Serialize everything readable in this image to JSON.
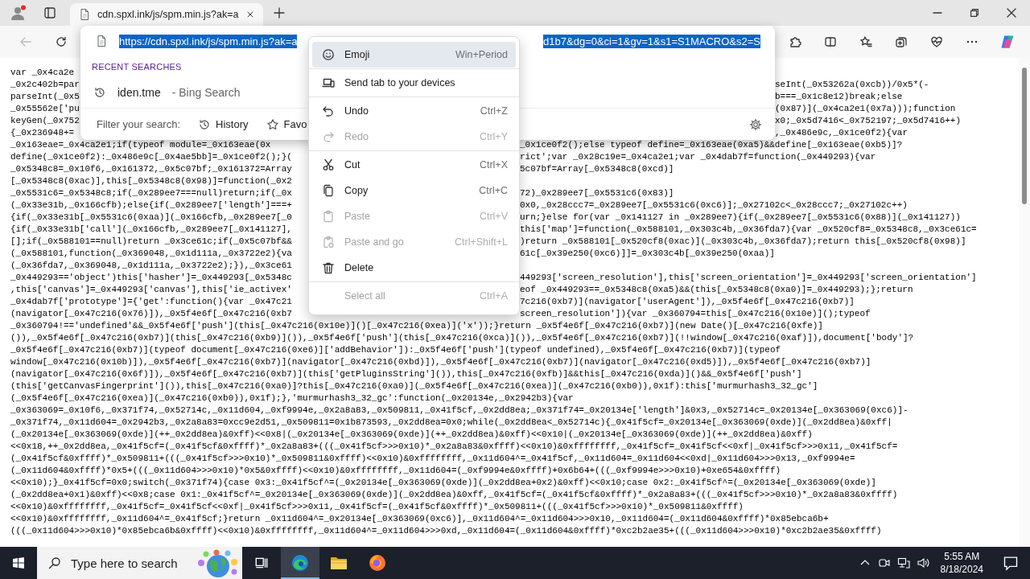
{
  "tabs": [
    {
      "title": "cdn.spxl.ink/js/spm.min.js?ak=a",
      "selected": true
    }
  ],
  "address_dropdown": {
    "url_start": "https://cdn.spxl.ink/js/spm.min.js?ak=a",
    "url_end": "d1b7&dg=0&ci=1&gv=1&s1=S1MACRO&s2=S",
    "url_selected": true,
    "section_title": "RECENT SEARCHES",
    "recent": [
      {
        "query": "iden.tme",
        "source": "- Bing Search"
      }
    ],
    "filter_label": "Filter your search:",
    "filters": [
      {
        "kind": "history",
        "label": "History"
      },
      {
        "kind": "favorites",
        "label": "Favo"
      }
    ]
  },
  "context_menu": {
    "groups": [
      [
        {
          "kind": "emoji",
          "label": "Emoji",
          "shortcut": "Win+Period",
          "highlighted": true,
          "disabled": false
        }
      ],
      [
        {
          "kind": "send",
          "label": "Send tab to your devices",
          "highlighted": false,
          "disabled": false
        }
      ],
      [
        {
          "kind": "undo",
          "label": "Undo",
          "shortcut": "Ctrl+Z",
          "highlighted": false,
          "disabled": false
        },
        {
          "kind": "redo",
          "label": "Redo",
          "shortcut": "Ctrl+Y",
          "highlighted": false,
          "disabled": true
        }
      ],
      [
        {
          "kind": "cut",
          "label": "Cut",
          "shortcut": "Ctrl+X",
          "highlighted": false,
          "disabled": false
        },
        {
          "kind": "copy",
          "label": "Copy",
          "shortcut": "Ctrl+C",
          "highlighted": false,
          "disabled": false
        },
        {
          "kind": "paste",
          "label": "Paste",
          "shortcut": "Ctrl+V",
          "highlighted": false,
          "disabled": true
        },
        {
          "kind": "paste-go",
          "label": "Paste and go",
          "shortcut": "Ctrl+Shift+L",
          "highlighted": false,
          "disabled": true
        },
        {
          "kind": "delete",
          "label": "Delete",
          "highlighted": false,
          "disabled": false
        }
      ],
      [
        {
          "kind": "select-all",
          "label": "Select all",
          "shortcut": "Ctrl+A",
          "highlighted": false,
          "disabled": true
        }
      ]
    ]
  },
  "code_lines": [
    {
      "left": "var _0x4ca2e"
    },
    {
      "left": "_0x2c402b=par",
      "right": "seInt(_0x53262a(0xcb))/0x5*(-"
    },
    {
      "left": "parseInt(_0x5",
      "right": "b===_0x1c8e12)break;else"
    },
    {
      "left": "_0x55562e['pu",
      "right": "(0x87)](_0x4ca2e1(0x7a)));function"
    },
    {
      "left": "keyGen(_0x752",
      "right": "x0;_0x5d7416<_0x752197;_0x5d7416++)"
    },
    {
      "left": "{_0x236948+=",
      "right": ",_0x486e9c,_0x1ce0f2){var"
    },
    {
      "left": "_0x163eae=_0x4ca2e1;if(typeof module=_0x163eae(0x",
      "right": "_0x1ce0f2();else typeof define=_0x163eae(0xa5)&&define[_0x163eae(0xb5)]?"
    },
    {
      "left": "define(_0x1ce0f2):_0x486e9c[_0x4ae5bb]=_0x1ce0f2();}(",
      "right": "rict';var _0x28c19e=_0x4ca2e1;var _0x4dab7f=function(_0x449293){var"
    },
    {
      "left": "_0x5348c8=_0x10f6,_0x161372,_0x5c07bf;_0x161372=Array",
      "right": "5c07bf=Array[_0x5348c8(0xcd)]"
    },
    {
      "left": "[_0x5348c8(0xac)],this[_0x5348c8(0x98)]=function(_0x2"
    },
    {
      "left": "_0x5531c6=_0x5348c8;if(_0x289ee7===null)return;if(_0x",
      "right": "72)_0x289ee7[_0x5531c6(0x83)]"
    },
    {
      "left": "(_0x33e31b,_0x166cfb);else{if(_0x289ee7['length']===+",
      "right": "0x0,_0x28ccc7=_0x289ee7[_0x5531c6(0xc6)];_0x27102c<_0x28ccc7;_0x27102c++)"
    },
    {
      "left": "{if(_0x33e31b[_0x5531c6(0xaa)](_0x166cfb,_0x289ee7[_0",
      "right": "urn;}else for(var _0x141127 in _0x289ee7){if(_0x289ee7[_0x5531c6(0x88)](_0x141127))"
    },
    {
      "left": "{if(_0x33e31b['call'](_0x166cfb,_0x289ee7[_0x141127],",
      "right": "this['map']=function(_0x588101,_0x303c4b,_0x36fda7){var _0x520cf8=_0x5348c8,_0x3ce61c="
    },
    {
      "left": "[];if(_0x588101==null)return _0x3ce61c;if(_0x5c07bf&&",
      "right": ")return _0x588101[_0x520cf8(0xac)](_0x303c4b,_0x36fda7);return this[_0x520cf8(0x98)]"
    },
    {
      "left": "(_0x588101,function(_0x369048,_0x1d111a,_0x3722e2){va",
      "right": "61c[_0x39e250(0xc6)]]=_0x303c4b[_0x39e250(0xaa)]"
    },
    {
      "left": "(_0x36fda7,_0x369048,_0x1d111a,_0x3722e2);}),_0x3ce61"
    },
    {
      "left": "_0x449293=='object')this['hasher']=_0x449293[_0x5348c",
      "right": "449293['screen_resolution'],this['screen_orientation']=_0x449293['screen_orientation']"
    },
    {
      "left": ",this['canvas']=_0x449293['canvas'],this['ie_activex'",
      "right": "eof _0x449293==_0x5348c8(0xa5)&&(this[_0x5348c8(0xa0)]=_0x449293);};return"
    },
    {
      "left": "_0x4dab7f['prototype']={'get':function(){var _0x47c21",
      "right": "7c216(0xb7)](navigator['userAgent']),_0x5f4e6f[_0x47c216(0xb7)]"
    },
    {
      "left": "(navigator[_0x47c216(0x76)]),_0x5f4e6f[_0x47c216(0xb7",
      "right": "screen_resolution']){var _0x360794=this[_0x47c216(0x10e)]();typeof"
    },
    {
      "text": "_0x360794!=='undefined'&&_0x5f4e6f['push'](this[_0x47c216(0x10e)]()[_0x47c216(0xea)]('x'));}return _0x5f4e6f[_0x47c216(0xb7)](new Date()[_0x47c216(0xfe)]"
    },
    {
      "text": "()),_0x5f4e6f[_0x47c216(0xb7)](this[_0x47c216(0xb9)]()),_0x5f4e6f['push'](this[_0x47c216(0xca)]()),_0x5f4e6f[_0x47c216(0xb7)](!!window[_0x47c216(0xaf)]),document['body']?"
    },
    {
      "text": "_0x5f4e6f[_0x47c216(0xb7)](typeof document[_0x47c216(0xe6)]['addBehavior']):_0x5f4e6f['push'](typeof undefined),_0x5f4e6f[_0x47c216(0xb7)](typeof"
    },
    {
      "text": "window[_0x47c216(0x10b)]),_0x5f4e6f[_0x47c216(0xb7)](navigator[_0x47c216(0xbd)]),_0x5f4e6f[_0x47c216(0xb7)](navigator[_0x47c216(0xd5)]),_0x5f4e6f[_0x47c216(0xb7)]"
    },
    {
      "text": "(navigator[_0x47c216(0x6f)]),_0x5f4e6f[_0x47c216(0xb7)](this['getPluginsString']()),this[_0x47c216(0xfb)]&&this[_0x47c216(0xda)]()&&_0x5f4e6f['push']"
    },
    {
      "text": "(this['getCanvasFingerprint']()),this[_0x47c216(0xa0)]?this[_0x47c216(0xa0)](_0x5f4e6f[_0x47c216(0xea)](_0x47c216(0xb0)),0x1f):this['murmurhash3_32_gc']"
    },
    {
      "text": "(_0x5f4e6f[_0x47c216(0xea)](_0x47c216(0xb0)),0x1f);},'murmurhash3_32_gc':function(_0x20134e,_0x2942b3){var"
    },
    {
      "text": "_0x363069=_0x10f6,_0x371f74,_0x52714c,_0x11d604,_0xf9994e,_0x2a8a83,_0x509811,_0x41f5cf,_0x2dd8ea;_0x371f74=_0x20134e['length']&0x3,_0x52714c=_0x20134e[_0x363069(0xc6)]-"
    },
    {
      "text": "_0x371f74,_0x11d604=_0x2942b3,_0x2a8a83=0xcc9e2d51,_0x509811=0x1b873593,_0x2dd8ea=0x0;while(_0x2dd8ea<_0x52714c){_0x41f5cf=_0x20134e[_0x363069(0xde)](_0x2dd8ea)&0xff|"
    },
    {
      "text": "(_0x20134e[_0x363069(0xde)](++_0x2dd8ea)&0xff)<<0x8|(_0x20134e[_0x363069(0xde)](++_0x2dd8ea)&0xff)<<0x10|(_0x20134e[_0x363069(0xde)](++_0x2dd8ea)&0xff)"
    },
    {
      "text": "<<0x18,++_0x2dd8ea,_0x41f5cf=(_0x41f5cf&0xffff)*_0x2a8a83+(((_0x41f5cf>>>0x10)*_0x2a8a83&0xffff)<<0x10)&0xffffffff,_0x41f5cf=_0x41f5cf<<0xf|_0x41f5cf>>>0x11,_0x41f5cf="
    },
    {
      "text": "(_0x41f5cf&0xffff)*_0x509811+(((_0x41f5cf>>>0x10)*_0x509811&0xffff)<<0x10)&0xffffffff,_0x11d604^=_0x41f5cf,_0x11d604=_0x11d604<<0xd|_0x11d604>>>0x13,_0xf9994e="
    },
    {
      "text": "(_0x11d604&0xffff)*0x5+(((_0x11d604>>>0x10)*0x5&0xffff)<<0x10)&0xffffffff,_0x11d604=(_0xf9994e&0xffff)+0x6b64+(((_0xf9994e>>>0x10)+0xe654&0xffff)"
    },
    {
      "text": "<<0x10);}_0x41f5cf=0x0;switch(_0x371f74){case 0x3:_0x41f5cf^=(_0x20134e[_0x363069(0xde)](_0x2dd8ea+0x2)&0xff)<<0x10;case 0x2:_0x41f5cf^=(_0x20134e[_0x363069(0xde)]"
    },
    {
      "text": "(_0x2dd8ea+0x1)&0xff)<<0x8;case 0x1:_0x41f5cf^=_0x20134e[_0x363069(0xde)](_0x2dd8ea)&0xff,_0x41f5cf=(_0x41f5cf&0xffff)*_0x2a8a83+(((_0x41f5cf>>>0x10)*_0x2a8a83&0xffff)"
    },
    {
      "text": "<<0x10)&0xffffffff,_0x41f5cf=_0x41f5cf<<0xf|_0x41f5cf>>>0x11,_0x41f5cf=(_0x41f5cf&0xffff)*_0x509811+(((_0x41f5cf>>>0x10)*_0x509811&0xffff)"
    },
    {
      "text": "<<0x10)&0xffffffff,_0x11d604^=_0x41f5cf;}return _0x11d604^=_0x20134e[_0x363069(0xc6)],_0x11d604^=_0x11d604>>>0x10,_0x11d604=(_0x11d604&0xffff)*0x85ebca6b+"
    },
    {
      "text": "(((_0x11d604>>>0x10)*0x85ebca6b&0xffff)<<0x10)&0xffffffff,_0x11d604^=_0x11d604>>>0xd,_0x11d604=(_0x11d604&0xffff)*0xc2b2ae35+(((_0x11d604>>>0x10)*0xc2b2ae35&0xffff)"
    }
  ],
  "taskbar": {
    "search_placeholder": "Type here to search",
    "apps": [
      {
        "kind": "task-view",
        "selected": false
      },
      {
        "kind": "edge",
        "selected": true
      },
      {
        "kind": "folder",
        "selected": false
      },
      {
        "kind": "firefox",
        "selected": false
      }
    ],
    "time": "5:55 AM",
    "date": "8/18/2024"
  }
}
